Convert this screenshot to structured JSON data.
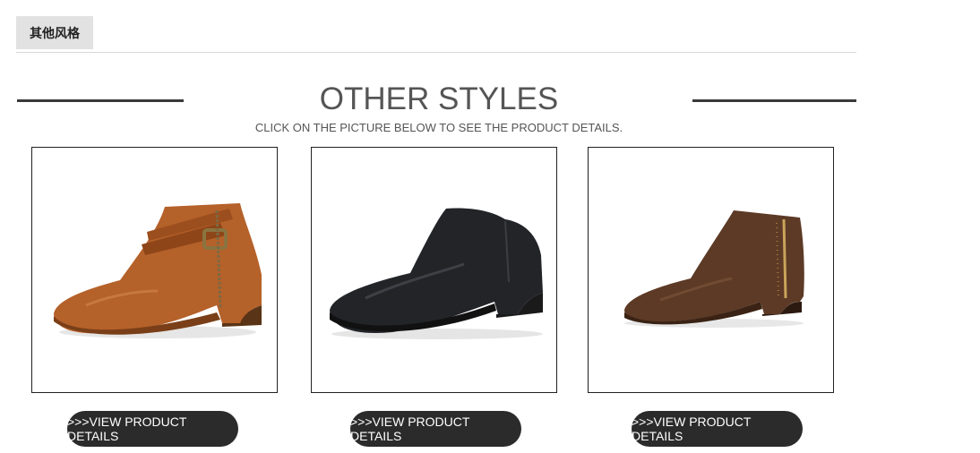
{
  "tab": {
    "label": "其他风格"
  },
  "header": {
    "title": "OTHER STYLES",
    "subtitle": "CLICK ON THE PICTURE BELOW TO SEE THE PRODUCT DETAILS."
  },
  "products": [
    {
      "button_label": ">>>VIEW PRODUCT DETAILS",
      "color": "#b5612a"
    },
    {
      "button_label": ">>>VIEW PRODUCT DETAILS",
      "color": "#222428"
    },
    {
      "button_label": ">>>VIEW PRODUCT DETAILS",
      "color": "#5c3a26"
    }
  ]
}
